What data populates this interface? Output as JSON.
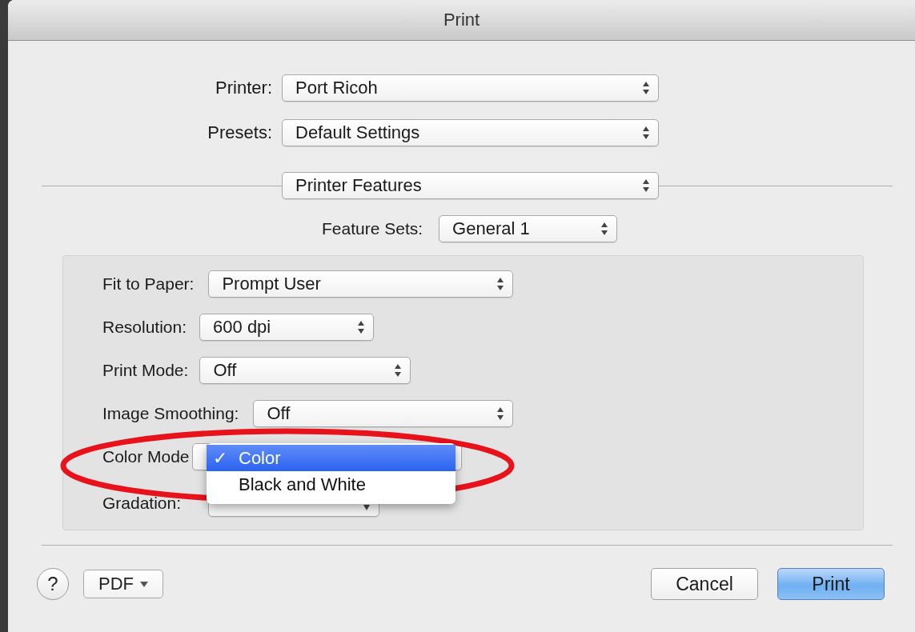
{
  "window": {
    "title": "Print"
  },
  "top_rows": [
    {
      "label": "Printer:",
      "value": "Port Ricoh"
    },
    {
      "label": "Presets:",
      "value": "Default Settings"
    }
  ],
  "panel_selector": {
    "value": "Printer Features"
  },
  "feature_sets": {
    "label": "Feature Sets:",
    "value": "General 1"
  },
  "options": [
    {
      "label": "Fit to Paper:",
      "value": "Prompt User"
    },
    {
      "label": "Resolution:",
      "value": "600 dpi"
    },
    {
      "label": "Print Mode:",
      "value": "Off"
    },
    {
      "label": "Image Smoothing:",
      "value": "Off"
    },
    {
      "label": "Color Mode"
    },
    {
      "label": "Gradation:",
      "covered": true
    }
  ],
  "popup_menu": {
    "items": [
      {
        "label": "Color",
        "check": "✓",
        "selected": true
      },
      {
        "label": "Black and White",
        "selected": false
      }
    ]
  },
  "footer": {
    "help": "?",
    "pdf": "PDF",
    "buttons": [
      {
        "label": "Cancel",
        "default": false
      },
      {
        "label": "Print",
        "default": true
      }
    ]
  }
}
